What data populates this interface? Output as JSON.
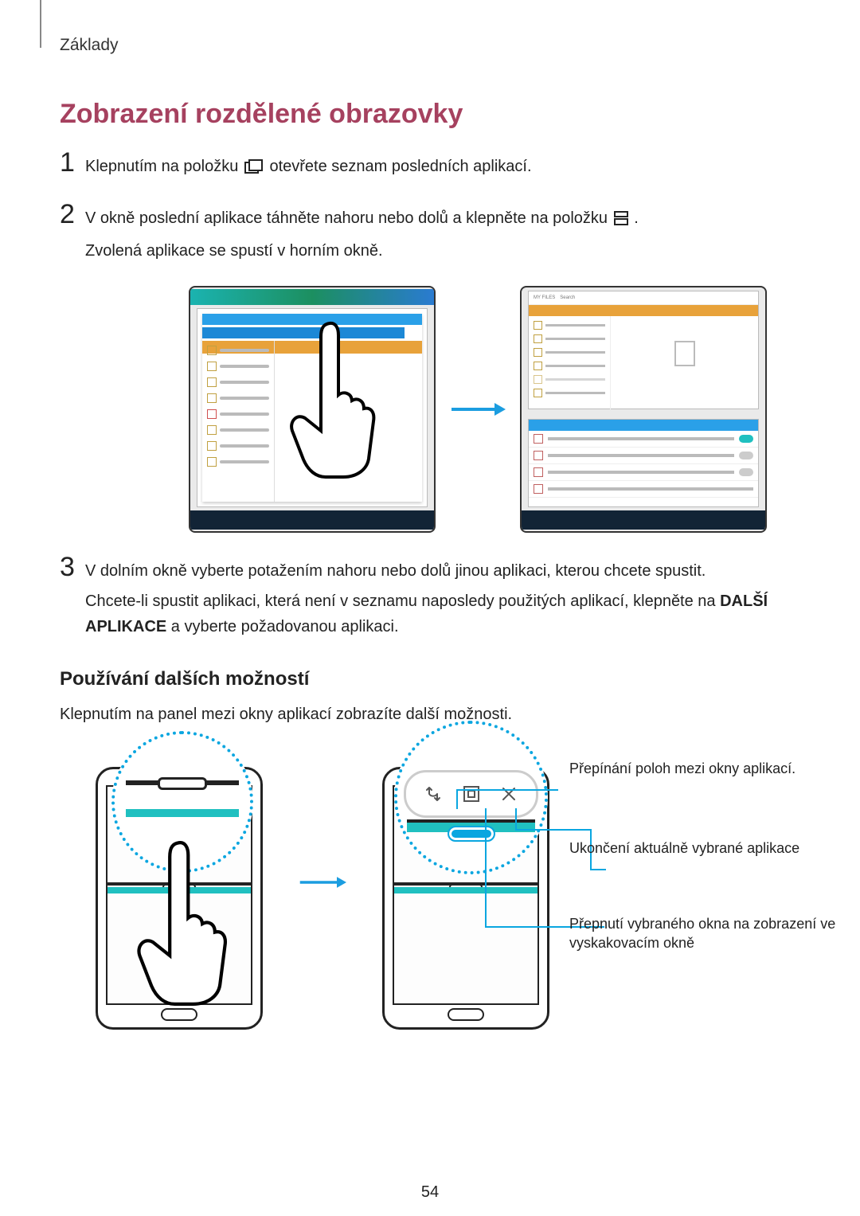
{
  "header": "Základy",
  "title": "Zobrazení rozdělené obrazovky",
  "steps": {
    "s1": {
      "num": "1",
      "pre": "Klepnutím na položku ",
      "post": " otevřete seznam posledních aplikací."
    },
    "s2": {
      "num": "2",
      "pre": "V okně poslední aplikace táhněte nahoru nebo dolů a klepněte na položku ",
      "post": ".",
      "line2": "Zvolená aplikace se spustí v horním okně."
    },
    "s3": {
      "num": "3",
      "line1": "V dolním okně vyberte potažením nahoru nebo dolů jinou aplikaci, kterou chcete spustit.",
      "line2a": "Chcete-li spustit aplikaci, která není v seznamu naposledy použitých aplikací, klepněte na ",
      "bold": "DALŠÍ APLIKACE",
      "line2b": " a vyberte požadovanou aplikaci."
    }
  },
  "subhead": "Používání dalších možností",
  "paragraph": "Klepnutím na panel mezi okny aplikací zobrazíte další možnosti.",
  "callouts": {
    "c1": "Přepínání poloh mezi okny aplikací.",
    "c2": "Ukončení aktuálně vybrané aplikace",
    "c3": "Přepnutí vybraného okna na zobrazení ve vyskakovacím okně"
  },
  "icons": {
    "recents": "recents-icon",
    "split": "split-icon",
    "swap": "swap-icon",
    "popup": "popup-icon",
    "close": "close-icon"
  },
  "page_number": "54"
}
